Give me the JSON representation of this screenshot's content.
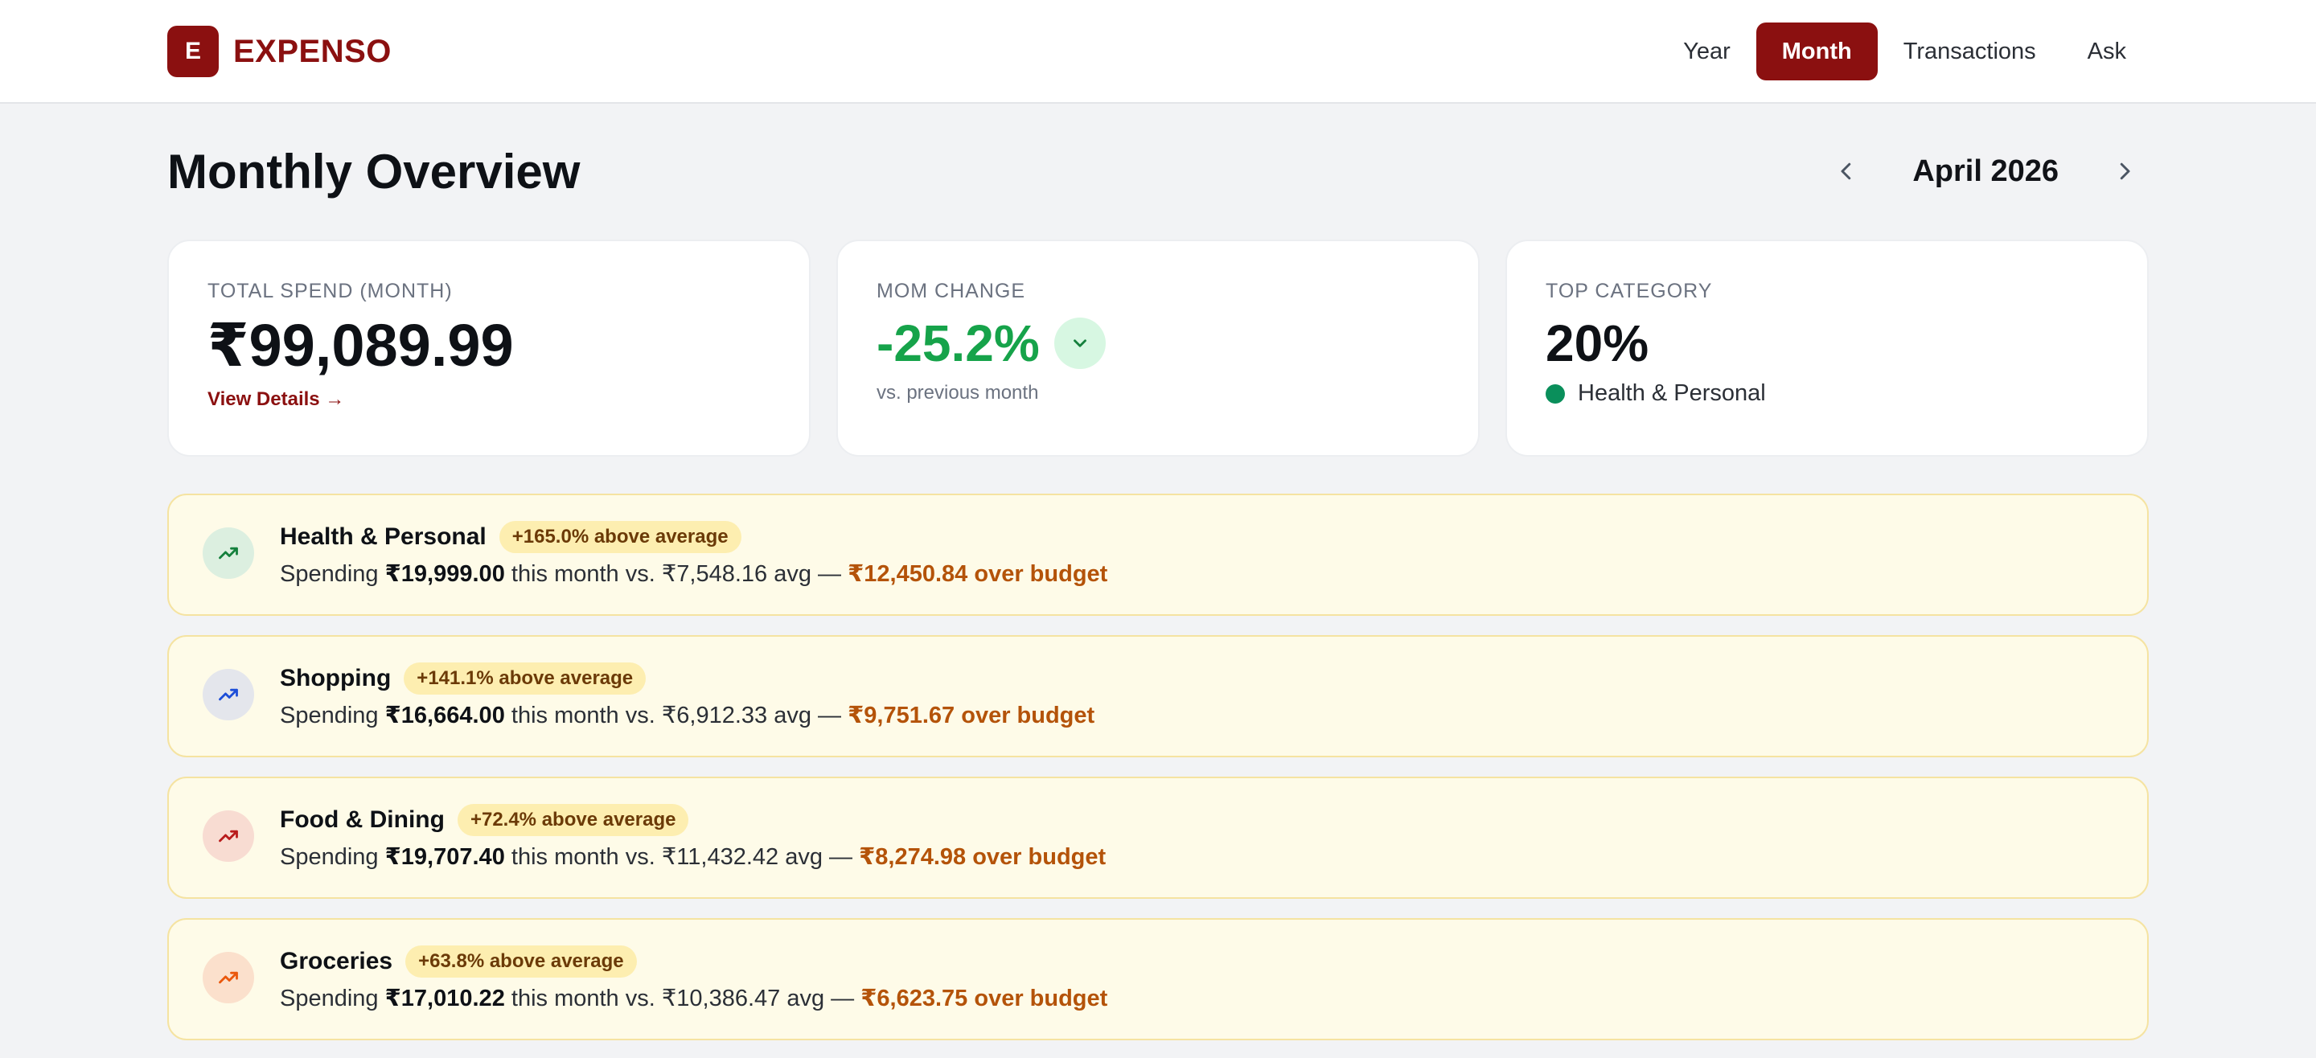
{
  "header": {
    "brand_mark": "E",
    "brand_name": "EXPENSO",
    "nav": [
      "Year",
      "Month",
      "Transactions",
      "Ask"
    ],
    "active_nav": "Month"
  },
  "page": {
    "title": "Monthly Overview",
    "month": "April 2026"
  },
  "cards": {
    "total": {
      "label": "TOTAL SPEND (MONTH)",
      "value": "₹99,089.99",
      "link": "View Details →"
    },
    "mom": {
      "label": "MOM CHANGE",
      "value": "-25.2%",
      "sub": "vs. previous month"
    },
    "top": {
      "label": "TOP CATEGORY",
      "value": "20%",
      "category": "Health & Personal"
    }
  },
  "alerts": [
    {
      "title": "Health & Personal",
      "pill": "+165.0% above average",
      "prefix": "Spending ",
      "amount": "₹19,999.00",
      "mid": " this month vs. ₹7,548.16 avg — ",
      "over": "₹12,450.84 over budget",
      "icon_bg": "#dcefe0",
      "icon_color": "#15803d"
    },
    {
      "title": "Shopping",
      "pill": "+141.1% above average",
      "prefix": "Spending ",
      "amount": "₹16,664.00",
      "mid": " this month vs. ₹6,912.33 avg — ",
      "over": "₹9,751.67 over budget",
      "icon_bg": "#e4e6ec",
      "icon_color": "#1d4ed8"
    },
    {
      "title": "Food & Dining",
      "pill": "+72.4% above average",
      "prefix": "Spending ",
      "amount": "₹19,707.40",
      "mid": " this month vs. ₹11,432.42 avg — ",
      "over": "₹8,274.98 over budget",
      "icon_bg": "#f8dcd2",
      "icon_color": "#b91c1c"
    },
    {
      "title": "Groceries",
      "pill": "+63.8% above average",
      "prefix": "Spending ",
      "amount": "₹17,010.22",
      "mid": " this month vs. ₹10,386.47 avg — ",
      "over": "₹6,623.75 over budget",
      "icon_bg": "#fbe0cc",
      "icon_color": "#ea580c"
    }
  ],
  "colors": {
    "brand": "#8b1010",
    "positive": "#16a34a",
    "warning": "#b45309"
  },
  "icons": {
    "prev": "chevron-left-icon",
    "next": "chevron-right-icon",
    "trend_down": "chevron-down-icon",
    "trend_up": "trending-up-icon"
  }
}
